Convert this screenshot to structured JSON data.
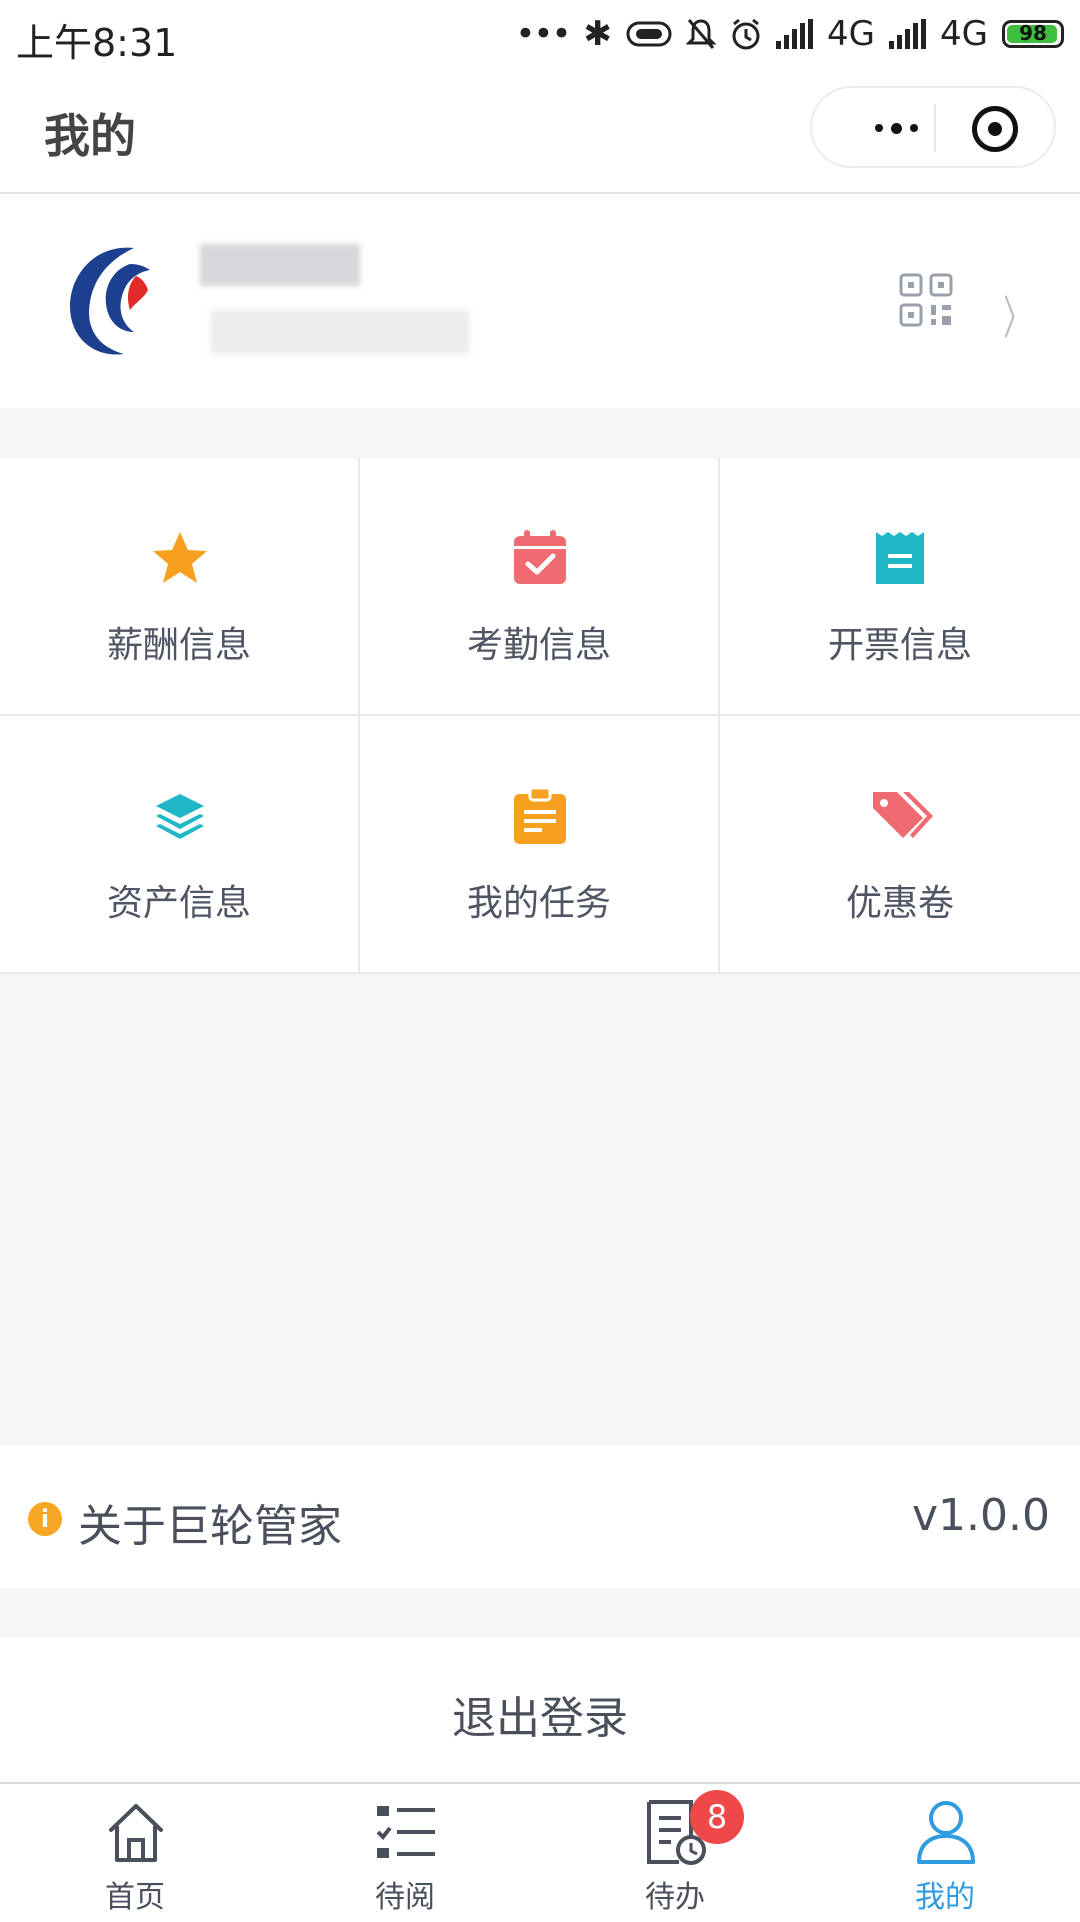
{
  "status_bar": {
    "time": "上午8:31",
    "network_1": "4G",
    "network_2": "4G",
    "hd": "HD",
    "battery": "98"
  },
  "header": {
    "title": "我的"
  },
  "grid": {
    "items": [
      {
        "label": "薪酬信息",
        "icon": "star-icon",
        "color": "#f7a020"
      },
      {
        "label": "考勤信息",
        "icon": "calendar-check-icon",
        "color": "#f06a72"
      },
      {
        "label": "开票信息",
        "icon": "receipt-icon",
        "color": "#1fb6c6"
      },
      {
        "label": "资产信息",
        "icon": "layers-icon",
        "color": "#1fb6c6"
      },
      {
        "label": "我的任务",
        "icon": "clipboard-icon",
        "color": "#f7a020"
      },
      {
        "label": "优惠卷",
        "icon": "tags-icon",
        "color": "#f06a72"
      }
    ]
  },
  "about": {
    "label": "关于巨轮管家",
    "version": "v1.0.0"
  },
  "logout": {
    "label": "退出登录"
  },
  "tabbar": {
    "items": [
      {
        "label": "首页",
        "icon": "home-icon"
      },
      {
        "label": "待阅",
        "icon": "checklist-icon"
      },
      {
        "label": "待办",
        "icon": "todo-clock-icon",
        "badge": "8"
      },
      {
        "label": "我的",
        "icon": "user-icon",
        "active": true
      }
    ]
  },
  "colors": {
    "accent": "#2f9be0",
    "badge": "#ee4848",
    "logo_blue": "#1d3f8f",
    "logo_red": "#e12a2a"
  }
}
